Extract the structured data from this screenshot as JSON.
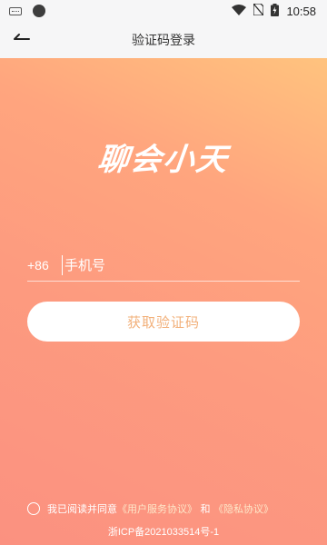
{
  "status_bar": {
    "time": "10:58",
    "icons": [
      "keyboard-icon",
      "notification-dot-icon",
      "wifi-icon",
      "no-sim-icon",
      "battery-charging-icon"
    ]
  },
  "nav": {
    "title": "验证码登录",
    "back_icon": "back-arrow-icon"
  },
  "logo_text": "聊会小天",
  "phone": {
    "country_code": "+86",
    "placeholder": "手机号",
    "value": ""
  },
  "get_code_button": "获取验证码",
  "agreement": {
    "checked": false,
    "prefix": "我已阅读并同意",
    "user_agreement": "《用户服务协议》",
    "connector": "和",
    "privacy_policy": "《隐私协议》"
  },
  "icp": "浙ICP备2021033514号-1",
  "colors": {
    "gradient_top": "#ffc37e",
    "gradient_bottom": "#fb9180",
    "button_text": "#f2b07a"
  }
}
